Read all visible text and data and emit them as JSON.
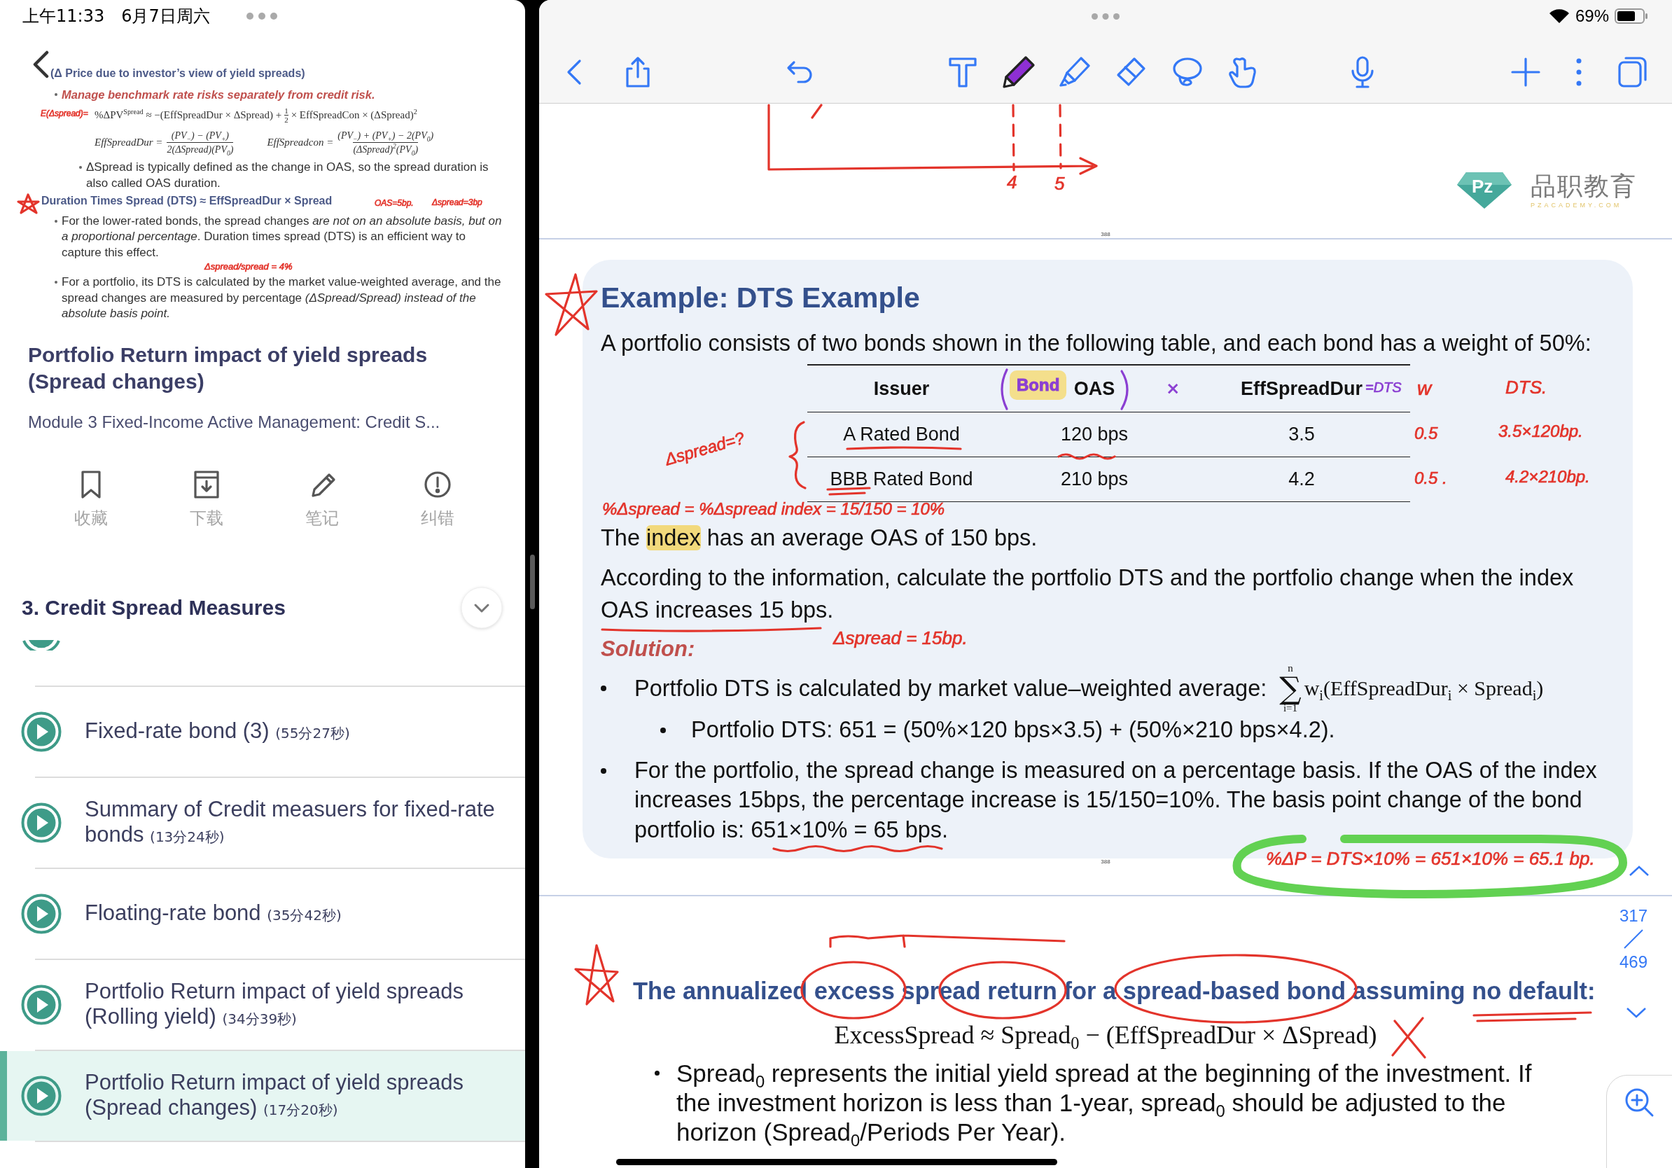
{
  "left_status": {
    "time": "上午11:33",
    "date": "6月7日周六"
  },
  "slide_preview": {
    "heading": "(Δ Price due to investor’s view of yield spreads)",
    "note": "Manage benchmark rate risks separately from credit risk.",
    "formula": {
      "left": "%ΔPV$^{Spread}$ ≈ −(EffSpreadDur × ΔSpread) +",
      "num": "1",
      "den": "2",
      "right": "× EffSpreadCon × (ΔSpread)$^{2}$"
    },
    "fractions": [
      {
        "lhs": "EffSpreadDur =",
        "num": "(PV$_{−}$) − (PV$_{+}$)",
        "den": "2(ΔSpread)(PV$_{0}$)"
      },
      {
        "lhs": "EffSpreadcon =",
        "num": "(PV$_{−}$) + (PV$_{+}$) − 2(PV$_{0}$)",
        "den": "(ΔSpread)$^{2}$(PV$_{0}$)"
      }
    ],
    "sub_note": "ΔSpread is typically defined as the change in OAS, so the spread duration is also called OAS duration.",
    "dts_heading": "Duration Times Spread (DTS) ≈ EffSpreadDur × Spread",
    "dts_points": [
      "For the lower-rated bonds, the spread changes *are not on an absolute basis, but on a proportional percentage*. Duration times spread (DTS) is an efficient way to capture this effect.",
      "For a portfolio, its DTS is calculated by the market value-weighted average, and the spread changes are measured by percentage *(ΔSpread/Spread) instead of the absolute basis point.*"
    ]
  },
  "lesson": {
    "title": "Portfolio Return impact of yield spreads (Spread changes)",
    "module": "Module 3 Fixed-Income Active Management: Credit S..."
  },
  "actions": [
    {
      "kind": "bookmark",
      "label": "收藏"
    },
    {
      "kind": "download",
      "label": "下载"
    },
    {
      "kind": "note",
      "label": "笔记"
    },
    {
      "kind": "report",
      "label": "纠错"
    }
  ],
  "section": {
    "title": "3. Credit Spread Measures"
  },
  "lessons": [
    {
      "title": "Fixed-rate bond (3)",
      "duration": "(55分27秒)",
      "selected": false
    },
    {
      "title": "Summary of Credit measuers for fixed-rate bonds",
      "duration": "(13分24秒)",
      "selected": false
    },
    {
      "title": "Floating-rate bond",
      "duration": "(35分42秒)",
      "selected": false
    },
    {
      "title": "Portfolio Return impact of yield spreads (Rolling yield)",
      "duration": "(34分39秒)",
      "selected": false
    },
    {
      "title": "Portfolio Return impact of yield spreads (Spread changes)",
      "duration": "(17分20秒)",
      "selected": true
    }
  ],
  "right_status": {
    "battery": "69%"
  },
  "tools": [
    {
      "kind": "text",
      "selected": false
    },
    {
      "kind": "pen",
      "selected": true
    },
    {
      "kind": "highlighter",
      "selected": false
    },
    {
      "kind": "eraser",
      "selected": false
    },
    {
      "kind": "lasso",
      "selected": false
    },
    {
      "kind": "hand",
      "selected": false
    }
  ],
  "page_top": {
    "logo": {
      "mark": "Pz",
      "name": "品职教育",
      "site": "PZACADEMY.COM"
    }
  },
  "page_marks": [
    "388",
    "388"
  ],
  "example": {
    "title": "Example: DTS Example",
    "intro": "A portfolio consists of two bonds shown in the following table, and each bond has a weight of 50%:",
    "table": {
      "columns": [
        "Issuer",
        "OAS",
        "EffSpreadDur"
      ],
      "rows": [
        [
          "A Rated Bond",
          "120 bps",
          "3.5"
        ],
        [
          "BBB Rated Bond",
          "210 bps",
          "4.2"
        ]
      ]
    },
    "index_line": {
      "parts": [
        {
          "text": "The ",
          "highlighted": false
        },
        {
          "text": "index",
          "highlighted": true
        },
        {
          "text": " has an average OAS of 150 bps.",
          "highlighted": false
        }
      ]
    },
    "question": "According to the information, calculate the portfolio DTS and the portfolio change when the index OAS increases 15 bps.",
    "solution_label": "Solution:",
    "bullets": [
      {
        "kind": "formula",
        "text": "Portfolio DTS is calculated by market value–weighted average:",
        "sum": {
          "sign": "∑",
          "upper": "n",
          "lower": "i=1",
          "body": "w$_{i}$(EffSpreadDur$_{i}$ × Spread$_{i}$)"
        },
        "children": [
          {
            "kind": "text",
            "text": "Portfolio DTS: 651 = (50%×120 bps×3.5) + (50%×210 bps×4.2)."
          }
        ]
      },
      {
        "kind": "text",
        "text": "For the portfolio, the spread change is measured on a percentage basis. If the OAS of the index increases 15bps, the percentage increase is 15/150=10%. The basis point change of the bond portfolio is: 651×10% = 65 bps."
      }
    ]
  },
  "next_page": {
    "heading": "The annualized excess spread return for a spread-based bond assuming no default:",
    "formula": "ExcessSpread ≈ Spread$_{0}$ − (EffSpreadDur × ΔSpread)",
    "bullet": "Spread$_{0}$ represents the initial yield spread at the beginning of the investment. If the investment horizon is less than 1-year, spread$_{0}$ should be adjusted to the horizon (Spread$_{0}$/Periods Per Year)."
  },
  "pager": {
    "current": "317",
    "total": "469"
  },
  "ink_notes": [
    {
      "text": "E(Δspread)=",
      "color": "#e3342b",
      "highlighted": false
    },
    {
      "text": "OAS=5bp.",
      "color": "#e3342b",
      "highlighted": false
    },
    {
      "text": "Δspread=3bp",
      "color": "#e3342b",
      "highlighted": false
    },
    {
      "text": "Δspread/spread = 4%",
      "color": "#e3342b",
      "highlighted": false
    },
    {
      "text": "4",
      "color": "#e3342b",
      "highlighted": false
    },
    {
      "text": "5",
      "color": "#e3342b",
      "highlighted": false
    },
    {
      "text": "Bond",
      "color": "#8b3fd2",
      "highlighted": true
    },
    {
      "text": "×",
      "color": "#8b3fd2",
      "highlighted": false
    },
    {
      "text": "=DTS",
      "color": "#8b3fd2",
      "highlighted": false
    },
    {
      "text": "w",
      "color": "#e3342b",
      "highlighted": false
    },
    {
      "text": "DTS.",
      "color": "#e3342b",
      "highlighted": false
    },
    {
      "text": "0.5",
      "color": "#e3342b",
      "highlighted": false
    },
    {
      "text": "3.5×120bp.",
      "color": "#e3342b",
      "highlighted": false
    },
    {
      "text": "0.5 .",
      "color": "#e3342b",
      "highlighted": false
    },
    {
      "text": "4.2×210bp.",
      "color": "#e3342b",
      "highlighted": false
    },
    {
      "text": "Δspread=?",
      "color": "#e3342b",
      "highlighted": false
    },
    {
      "text": "%Δspread = %Δspread index = 15/150 = 10%",
      "color": "#e3342b",
      "highlighted": false
    },
    {
      "text": "Δspread = 15bp.",
      "color": "#e3342b",
      "highlighted": false
    },
    {
      "text": "%ΔP = DTS×10% = 651×10% = 65.1 bp.",
      "color": "#e3342b",
      "highlighted": false
    }
  ]
}
